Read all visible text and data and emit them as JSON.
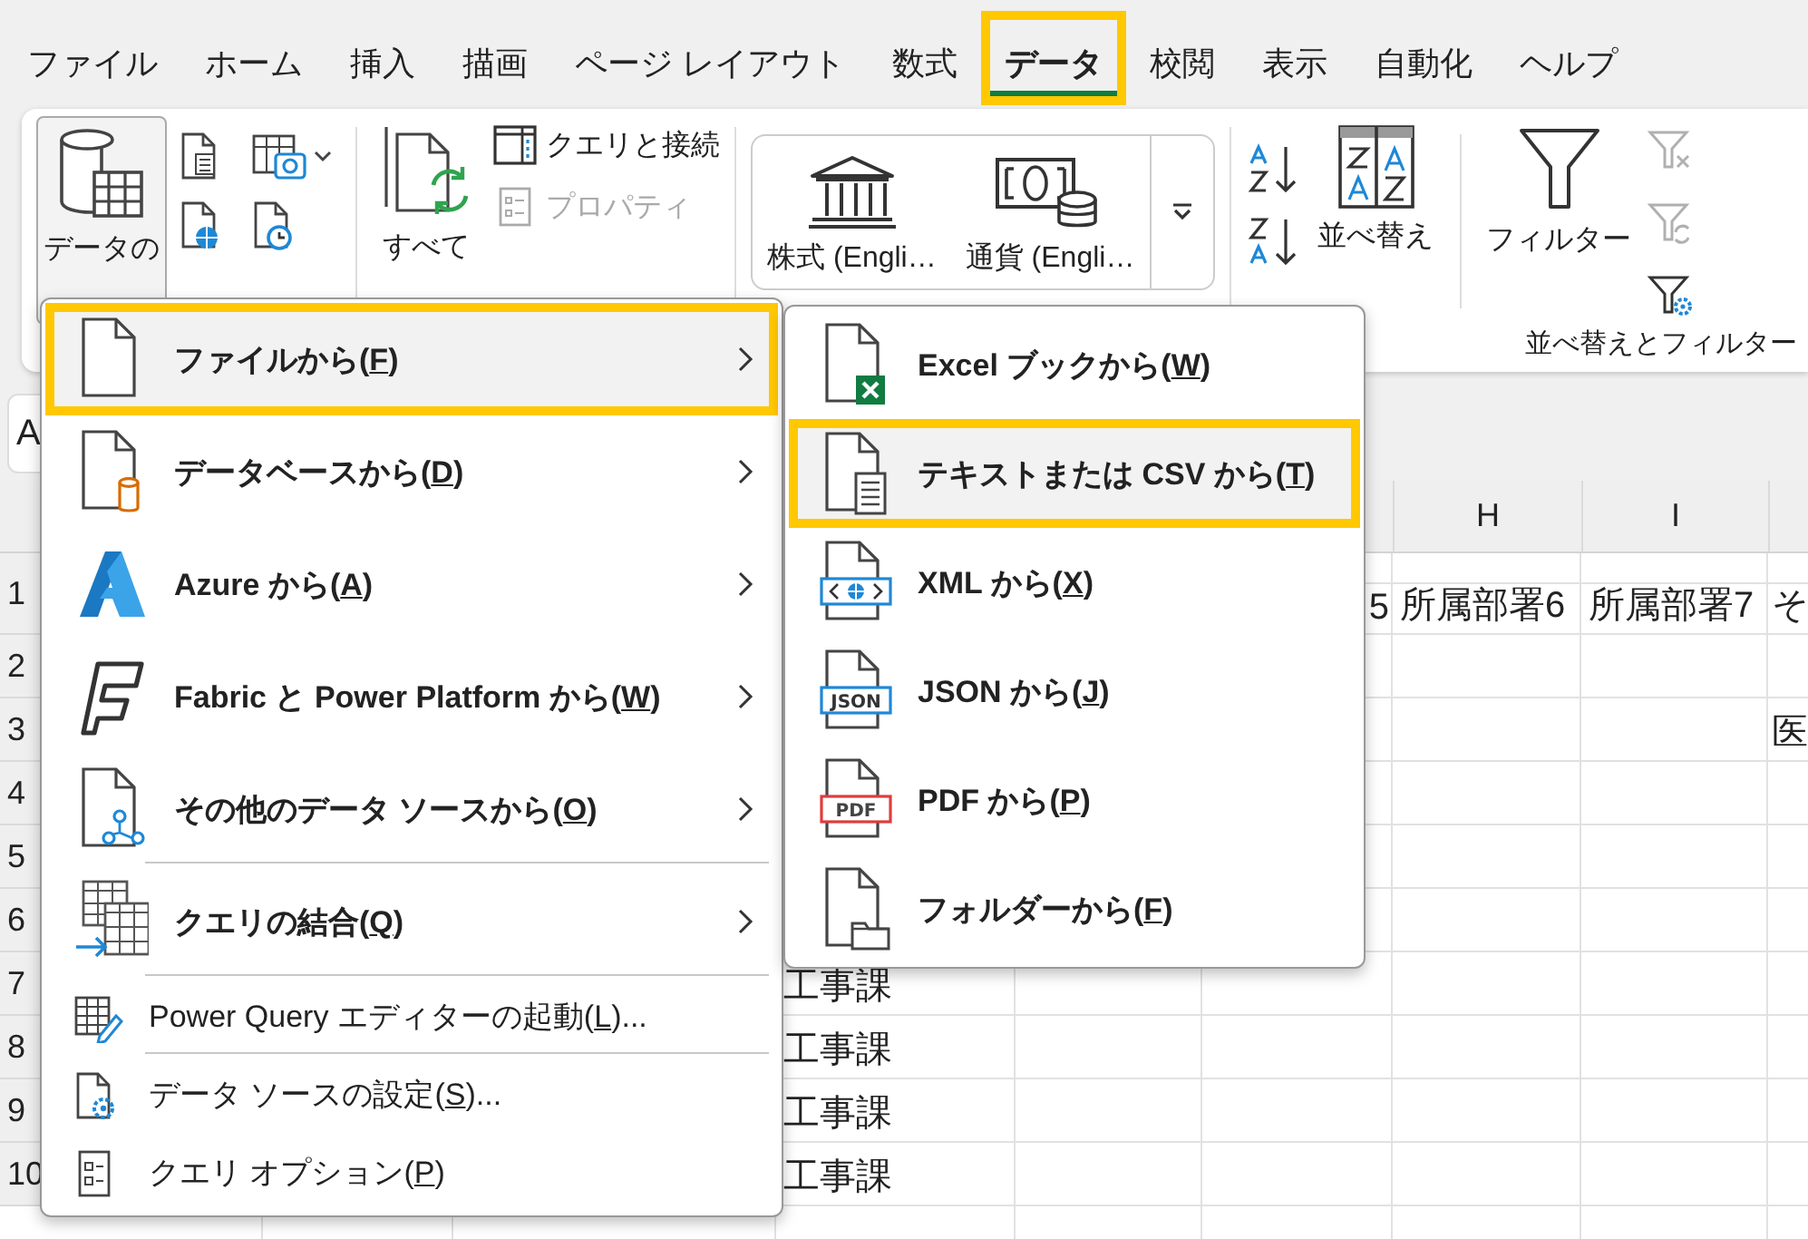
{
  "tabs": [
    {
      "label": "ファイル",
      "selected": false,
      "highlighted": false
    },
    {
      "label": "ホーム",
      "selected": false,
      "highlighted": false
    },
    {
      "label": "挿入",
      "selected": false,
      "highlighted": false
    },
    {
      "label": "描画",
      "selected": false,
      "highlighted": false
    },
    {
      "label": "ページ レイアウト",
      "selected": false,
      "highlighted": false
    },
    {
      "label": "数式",
      "selected": false,
      "highlighted": false
    },
    {
      "label": "データ",
      "selected": true,
      "highlighted": true
    },
    {
      "label": "校閲",
      "selected": false,
      "highlighted": false
    },
    {
      "label": "表示",
      "selected": false,
      "highlighted": false
    },
    {
      "label": "自動化",
      "selected": false,
      "highlighted": false
    },
    {
      "label": "ヘルプ",
      "selected": false,
      "highlighted": false
    }
  ],
  "ribbon": {
    "get_data": {
      "label": "データの"
    },
    "refresh_all": {
      "label": "すべて"
    },
    "queries": [
      {
        "label": "クエリと接続",
        "disabled": false
      },
      {
        "label": "プロパティ",
        "disabled": true
      }
    ],
    "data_types": [
      {
        "label": "株式 (Engli…"
      },
      {
        "label": "通貨 (Engli…"
      }
    ],
    "sort": {
      "label": "並べ替え"
    },
    "filter": {
      "label": "フィルター"
    },
    "filter_tools": [
      {
        "disabled": true
      },
      {
        "disabled": true
      },
      {
        "disabled": false
      }
    ],
    "group_label": "並べ替えとフィルター"
  },
  "name_box": {
    "value": "A"
  },
  "sheet": {
    "column_headers": {
      "column_h": "H",
      "column_i": "I"
    },
    "rows": [
      {
        "number": "1",
        "cells": {
          "column_g": "5",
          "column_h": "所属部署6",
          "column_i": "所属部署7",
          "column_j": "そ"
        }
      },
      {
        "number": "2"
      },
      {
        "number": "3",
        "cells": {
          "column_j": "医"
        }
      },
      {
        "number": "4"
      },
      {
        "number": "5"
      },
      {
        "number": "6"
      },
      {
        "number": "7",
        "cells": {
          "column_d": "工事課"
        }
      },
      {
        "number": "8",
        "cells": {
          "column_d": "工事課"
        }
      },
      {
        "number": "9",
        "cells": {
          "column_d": "工事課"
        }
      },
      {
        "number": "10",
        "cells": {
          "column_d": "工事課"
        }
      }
    ]
  },
  "menu": {
    "items": [
      {
        "kind": "large",
        "label": "ファイルから(",
        "key": "F",
        "label_end": ")",
        "submenu": true,
        "selected": true,
        "highlighted": true,
        "divider": false
      },
      {
        "kind": "large",
        "label": "データベースから(",
        "key": "D",
        "label_end": ")",
        "submenu": true,
        "selected": false,
        "highlighted": false,
        "divider": false
      },
      {
        "kind": "large",
        "label": "Azure から(",
        "key": "A",
        "label_end": ")",
        "submenu": true,
        "selected": false,
        "highlighted": false,
        "divider": false
      },
      {
        "kind": "large",
        "label": "Fabric と Power Platform から(",
        "key": "W",
        "label_end": ")",
        "submenu": true,
        "selected": false,
        "highlighted": false,
        "divider": false
      },
      {
        "kind": "large",
        "label": "その他のデータ ソースから(",
        "key": "O",
        "label_end": ")",
        "submenu": true,
        "selected": false,
        "highlighted": false,
        "divider": true
      },
      {
        "kind": "large",
        "label": "クエリの結合(",
        "key": "Q",
        "label_end": ")",
        "submenu": true,
        "selected": false,
        "highlighted": false,
        "divider": true
      },
      {
        "kind": "small",
        "label": "Power Query エディターの起動(",
        "key": "L",
        "label_end": ")...",
        "submenu": false,
        "selected": false,
        "highlighted": false,
        "divider": true
      },
      {
        "kind": "small",
        "label": "データ ソースの設定(",
        "key": "S",
        "label_end": ")...",
        "submenu": false,
        "selected": false,
        "highlighted": false,
        "divider": false
      },
      {
        "kind": "small",
        "label": "クエリ オプション(",
        "key": "P",
        "label_end": ")",
        "submenu": false,
        "selected": false,
        "highlighted": false,
        "divider": false
      }
    ]
  },
  "submenu": {
    "items": [
      {
        "label": "Excel ブックから(",
        "key": "W",
        "label_end": ")",
        "selected": false,
        "highlighted": false
      },
      {
        "label": "テキストまたは CSV から(",
        "key": "T",
        "label_end": ")",
        "selected": true,
        "highlighted": true
      },
      {
        "label": "XML から(",
        "key": "X",
        "label_end": ")",
        "selected": false,
        "highlighted": false
      },
      {
        "badge": "JSON",
        "label": "JSON から(",
        "key": "J",
        "label_end": ")",
        "selected": false,
        "highlighted": false
      },
      {
        "badge": "PDF",
        "label": "PDF から(",
        "key": "P",
        "label_end": ")",
        "selected": false,
        "highlighted": false
      },
      {
        "label": "フォルダーから(",
        "key": "F",
        "label_end": ")",
        "selected": false,
        "highlighted": false
      }
    ]
  }
}
